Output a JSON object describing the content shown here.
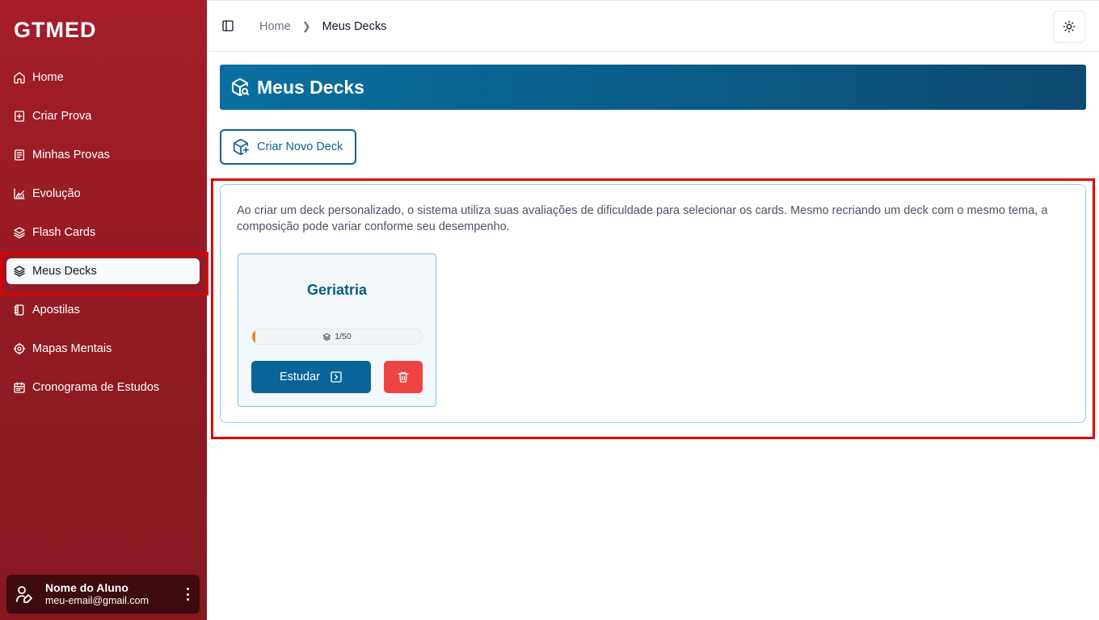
{
  "app": {
    "logo": "GTMED"
  },
  "sidebar": {
    "items": [
      {
        "label": "Home",
        "icon": "home-icon"
      },
      {
        "label": "Criar Prova",
        "icon": "file-plus-icon"
      },
      {
        "label": "Minhas Provas",
        "icon": "file-text-icon"
      },
      {
        "label": "Evolução",
        "icon": "chart-icon"
      },
      {
        "label": "Flash Cards",
        "icon": "layers-icon"
      },
      {
        "label": "Meus Decks",
        "icon": "layers-icon",
        "active": true
      },
      {
        "label": "Apostilas",
        "icon": "notebook-icon"
      },
      {
        "label": "Mapas Mentais",
        "icon": "cog-icon"
      },
      {
        "label": "Cronograma de Estudos",
        "icon": "calendar-icon"
      }
    ]
  },
  "user": {
    "name": "Nome do Aluno",
    "email": "meu-email@gmail.com"
  },
  "header": {
    "breadcrumb_home": "Home",
    "breadcrumb_current": "Meus Decks"
  },
  "page": {
    "title": "Meus Decks",
    "new_deck_label": "Criar Novo Deck",
    "info": "Ao criar um deck personalizado, o sistema utiliza suas avaliações de dificuldade para selecionar os cards. Mesmo recriando um deck com o mesmo tema, a composição pode variar conforme seu desempenho."
  },
  "decks": [
    {
      "title": "Geriatria",
      "progress_label": "1/50",
      "progress": 0.02,
      "study_label": "Estudar"
    }
  ],
  "colors": {
    "sidebar": "#a51d2a",
    "primary": "#0b6295",
    "danger": "#ef4444",
    "progress": "#ea8a1e",
    "highlight": "#e00000"
  }
}
